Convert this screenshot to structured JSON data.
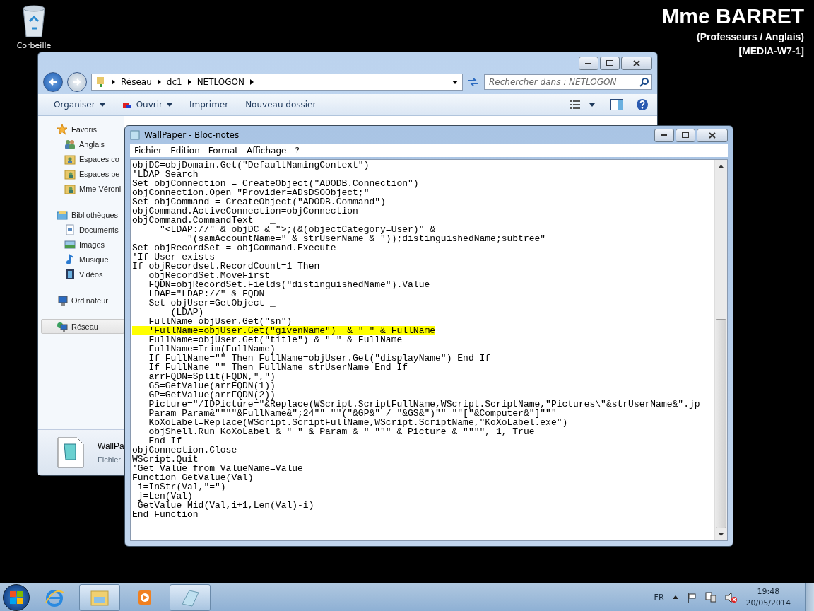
{
  "desktop_icons": [
    {
      "label": "Corbeille"
    }
  ],
  "user_info": {
    "name": "Mme BARRET",
    "group": "(Professeurs / Anglais)",
    "computer": "[MEDIA-W7-1]"
  },
  "explorer": {
    "breadcrumb": [
      "Réseau",
      "dc1",
      "NETLOGON"
    ],
    "search": {
      "placeholder": "Rechercher dans : NETLOGON"
    },
    "toolbar": [
      {
        "label": "Organiser",
        "dropdown": true
      },
      {
        "label": "Ouvrir",
        "dropdown": true
      },
      {
        "label": "Imprimer",
        "dropdown": false
      },
      {
        "label": "Nouveau dossier",
        "dropdown": false
      }
    ],
    "nav": [
      {
        "label": "Favoris",
        "kind": "star",
        "selected": false,
        "children": [
          {
            "label": "Anglais",
            "kind": "people",
            "selected": false
          },
          {
            "label": "Espaces co",
            "kind": "shared-folder",
            "selected": false
          },
          {
            "label": "Espaces pe",
            "kind": "user-folder",
            "selected": false
          },
          {
            "label": "Mme Véroni",
            "kind": "user-folder",
            "selected": false
          }
        ]
      },
      {
        "label": "Bibliothèques",
        "kind": "library",
        "selected": false,
        "children": [
          {
            "label": "Documents",
            "kind": "document",
            "selected": false
          },
          {
            "label": "Images",
            "kind": "picture",
            "selected": false
          },
          {
            "label": "Musique",
            "kind": "music",
            "selected": false
          },
          {
            "label": "Vidéos",
            "kind": "video",
            "selected": false
          }
        ]
      },
      {
        "label": "Ordinateur",
        "kind": "computer",
        "selected": false
      },
      {
        "label": "Réseau",
        "kind": "network",
        "selected": true
      }
    ],
    "details": {
      "name": "WallPa",
      "type": "Fichier"
    }
  },
  "notepad": {
    "title": "WallPaper - Bloc-notes",
    "menu": [
      "Fichier",
      "Edition",
      "Format",
      "Affichage",
      "?"
    ],
    "lines": [
      {
        "text": "objDC=objDomain.Get(\"DefaultNamingContext\")",
        "highlighted": false
      },
      {
        "text": "'LDAP Search",
        "highlighted": false
      },
      {
        "text": "Set objConnection = CreateObject(\"ADODB.Connection\")",
        "highlighted": false
      },
      {
        "text": "objConnection.Open \"Provider=ADsDSOObject;\"",
        "highlighted": false
      },
      {
        "text": "Set objCommand = CreateObject(\"ADODB.Command\")",
        "highlighted": false
      },
      {
        "text": "objCommand.ActiveConnection=objConnection",
        "highlighted": false
      },
      {
        "text": "objCommand.CommandText = _",
        "highlighted": false
      },
      {
        "text": "     \"<LDAP://\" & objDC & \">;(&(objectCategory=User)\" & _",
        "highlighted": false
      },
      {
        "text": "          \"(samAccountName=\" & strUserName & \"));distinguishedName;subtree\"",
        "highlighted": false
      },
      {
        "text": "Set objRecordSet = objCommand.Execute",
        "highlighted": false
      },
      {
        "text": "'If User exists",
        "highlighted": false
      },
      {
        "text": "If objRecordset.RecordCount=1 Then",
        "highlighted": false
      },
      {
        "text": "   objRecordSet.MoveFirst",
        "highlighted": false
      },
      {
        "text": "   FQDN=objRecordSet.Fields(\"distinguishedName\").Value",
        "highlighted": false
      },
      {
        "text": "   LDAP=\"LDAP://\" & FQDN",
        "highlighted": false
      },
      {
        "text": "   Set objUser=GetObject _",
        "highlighted": false
      },
      {
        "text": "       (LDAP)",
        "highlighted": false
      },
      {
        "text": "   FullName=objUser.Get(\"sn\")",
        "highlighted": false
      },
      {
        "text": "   'FullName=objUser.Get(\"givenName\")  & \" \" & FullName",
        "highlighted": true
      },
      {
        "text": "   FullName=objUser.Get(\"title\") & \" \" & FullName",
        "highlighted": false
      },
      {
        "text": "   FullName=Trim(FullName)",
        "highlighted": false
      },
      {
        "text": "   If FullName=\"\" Then FullName=objUser.Get(\"displayName\") End If",
        "highlighted": false
      },
      {
        "text": "   If FullName=\"\" Then FullName=strUserName End If",
        "highlighted": false
      },
      {
        "text": "   arrFQDN=Split(FQDN,\",\")",
        "highlighted": false
      },
      {
        "text": "   GS=GetValue(arrFQDN(1))",
        "highlighted": false
      },
      {
        "text": "   GP=GetValue(arrFQDN(2))",
        "highlighted": false
      },
      {
        "text": "   Picture=\"/IDPicture=\"&Replace(WScript.ScriptFullName,WScript.ScriptName,\"Pictures\\\"&strUserName&\".jp",
        "highlighted": false
      },
      {
        "text": "   Param=Param&\"\"\"\"&FullName&\";24\"\" \"\"(\"&GP&\" / \"&GS&\")\"\" \"\"[\"&Computer&\"]\"\"\"",
        "highlighted": false
      },
      {
        "text": "   KoXoLabel=Replace(WScript.ScriptFullName,WScript.ScriptName,\"KoXoLabel.exe\")",
        "highlighted": false
      },
      {
        "text": "   objShell.Run KoXoLabel & \" \" & Param & \" \"\"\" & Picture & \"\"\"\", 1, True",
        "highlighted": false
      },
      {
        "text": "   End If",
        "highlighted": false
      },
      {
        "text": "objConnection.Close",
        "highlighted": false
      },
      {
        "text": "WScript.Quit",
        "highlighted": false
      },
      {
        "text": "'Get Value from ValueName=Value",
        "highlighted": false
      },
      {
        "text": "Function GetValue(Val)",
        "highlighted": false
      },
      {
        "text": " i=InStr(Val,\"=\")",
        "highlighted": false
      },
      {
        "text": " j=Len(Val)",
        "highlighted": false
      },
      {
        "text": " GetValue=Mid(Val,i+1,Len(Val)-i)",
        "highlighted": false
      },
      {
        "text": "End Function",
        "highlighted": false
      }
    ]
  },
  "taskbar": {
    "apps": [
      {
        "kind": "browser",
        "open": false
      },
      {
        "kind": "explorer",
        "open": true
      },
      {
        "kind": "media",
        "open": false
      },
      {
        "kind": "notepad",
        "open": true
      }
    ],
    "language": "FR",
    "time": "19:48",
    "date": "20/05/2014"
  }
}
